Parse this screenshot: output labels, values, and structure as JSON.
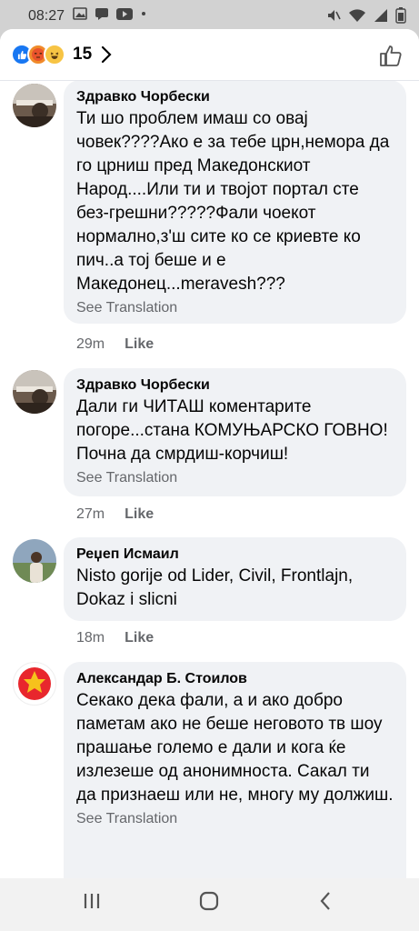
{
  "status_bar": {
    "time": "08:27"
  },
  "header": {
    "reaction_count": "15"
  },
  "comments": [
    {
      "author": "Здравко Чорбески",
      "text": "Ти шо проблем имаш со овај човек????Ако е за тебе црн,немора да го црниш пред Македонскиот Народ....Или ти и твојот портал сте без-грешни?????Фали чоекот нормално,з'ш сите ко се криевте ко пич..а тој беше и е Македонец...meravesh???",
      "translate": "See Translation",
      "time": "29m",
      "like": "Like"
    },
    {
      "author": "Здравко Чорбески",
      "text": "Дали ги ЧИТАШ коментарите погоре...стана КОМУЊАРСКО ГОВНО!Почна да смрдиш-корчиш!",
      "translate": "See Translation",
      "time": "27m",
      "like": "Like"
    },
    {
      "author": "Реџеп Исмаил",
      "text": "Nisto gorije od Lider, Civil, Frontlajn, Dokaz i slicni",
      "time": "18m",
      "like": "Like"
    },
    {
      "author": "Александар Б. Стоилов",
      "text": "Секако дека фали, а и ако добро паметам ако не беше неговото тв шоу прашање големо е дали и кога ќе излезеше од анонимноста. Сакал ти да признаеш или не, многу му должиш.",
      "translate": "See Translation"
    }
  ],
  "colors": {
    "accent": "#1877f2",
    "bubble": "#f0f2f5",
    "meta": "#65676b"
  }
}
